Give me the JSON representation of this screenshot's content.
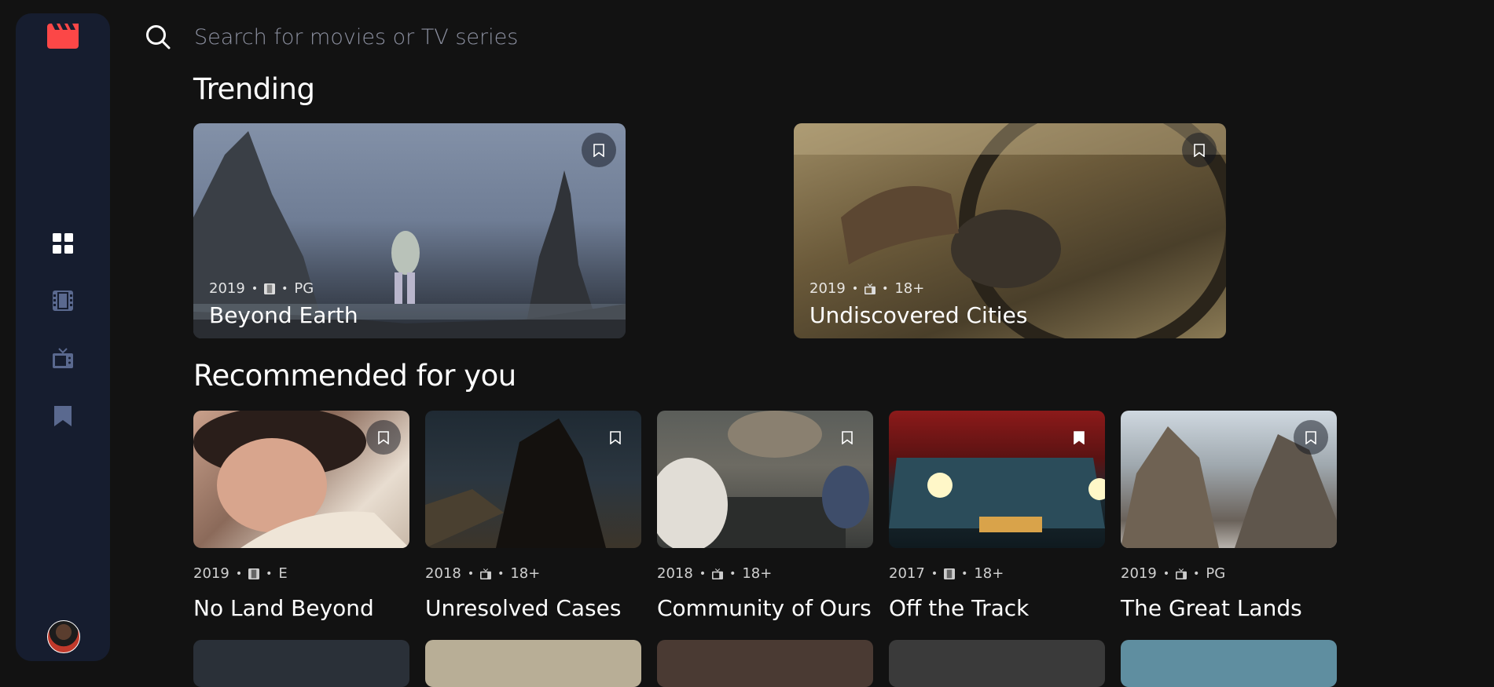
{
  "search": {
    "placeholder": "Search for movies or TV series"
  },
  "sections": {
    "trending": "Trending",
    "recommended": "Recommended for you"
  },
  "colors": {
    "accent": "#fc4747",
    "sidebar": "#161d2f",
    "background": "#121212"
  },
  "sidebar": {
    "items": [
      {
        "icon": "home-grid-icon",
        "active": true
      },
      {
        "icon": "movies-icon",
        "active": false
      },
      {
        "icon": "tv-series-icon",
        "active": false
      },
      {
        "icon": "bookmarks-icon",
        "active": false
      }
    ]
  },
  "trending": [
    {
      "year": "2019",
      "category": "movie",
      "rating": "PG",
      "title": "Beyond Earth",
      "bookmarked": false
    },
    {
      "year": "2019",
      "category": "tv",
      "rating": "18+",
      "title": "Undiscovered Cities",
      "bookmarked": false
    }
  ],
  "recommended": [
    {
      "year": "2019",
      "category": "movie",
      "rating": "E",
      "title": "No Land Beyond",
      "bookmarked": false
    },
    {
      "year": "2018",
      "category": "tv",
      "rating": "18+",
      "title": "Unresolved Cases",
      "bookmarked": false
    },
    {
      "year": "2018",
      "category": "tv",
      "rating": "18+",
      "title": "Community of Ours",
      "bookmarked": false
    },
    {
      "year": "2017",
      "category": "movie",
      "rating": "18+",
      "title": "Off the Track",
      "bookmarked": true
    },
    {
      "year": "2019",
      "category": "tv",
      "rating": "PG",
      "title": "The Great Lands",
      "bookmarked": false
    }
  ],
  "separator": "•"
}
